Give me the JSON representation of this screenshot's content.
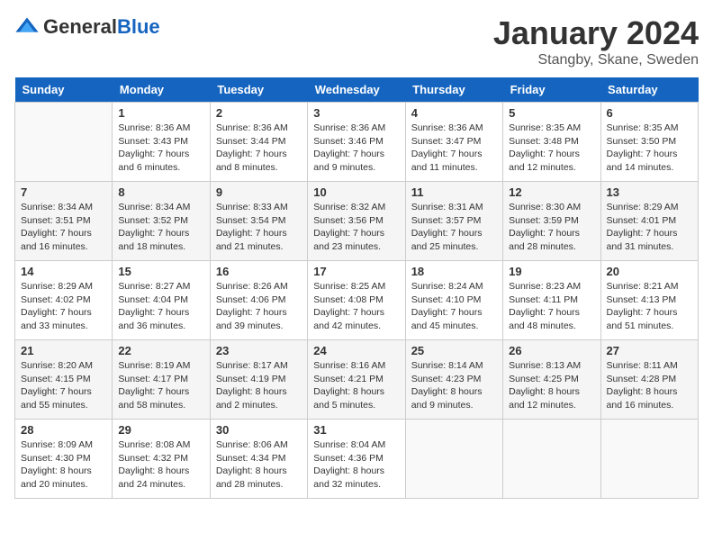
{
  "header": {
    "logo": {
      "general": "General",
      "blue": "Blue"
    },
    "title": "January 2024",
    "location": "Stangby, Skane, Sweden"
  },
  "weekdays": [
    "Sunday",
    "Monday",
    "Tuesday",
    "Wednesday",
    "Thursday",
    "Friday",
    "Saturday"
  ],
  "weeks": [
    [
      {
        "day": "",
        "info": ""
      },
      {
        "day": "1",
        "info": "Sunrise: 8:36 AM\nSunset: 3:43 PM\nDaylight: 7 hours\nand 6 minutes."
      },
      {
        "day": "2",
        "info": "Sunrise: 8:36 AM\nSunset: 3:44 PM\nDaylight: 7 hours\nand 8 minutes."
      },
      {
        "day": "3",
        "info": "Sunrise: 8:36 AM\nSunset: 3:46 PM\nDaylight: 7 hours\nand 9 minutes."
      },
      {
        "day": "4",
        "info": "Sunrise: 8:36 AM\nSunset: 3:47 PM\nDaylight: 7 hours\nand 11 minutes."
      },
      {
        "day": "5",
        "info": "Sunrise: 8:35 AM\nSunset: 3:48 PM\nDaylight: 7 hours\nand 12 minutes."
      },
      {
        "day": "6",
        "info": "Sunrise: 8:35 AM\nSunset: 3:50 PM\nDaylight: 7 hours\nand 14 minutes."
      }
    ],
    [
      {
        "day": "7",
        "info": "Sunrise: 8:34 AM\nSunset: 3:51 PM\nDaylight: 7 hours\nand 16 minutes."
      },
      {
        "day": "8",
        "info": "Sunrise: 8:34 AM\nSunset: 3:52 PM\nDaylight: 7 hours\nand 18 minutes."
      },
      {
        "day": "9",
        "info": "Sunrise: 8:33 AM\nSunset: 3:54 PM\nDaylight: 7 hours\nand 21 minutes."
      },
      {
        "day": "10",
        "info": "Sunrise: 8:32 AM\nSunset: 3:56 PM\nDaylight: 7 hours\nand 23 minutes."
      },
      {
        "day": "11",
        "info": "Sunrise: 8:31 AM\nSunset: 3:57 PM\nDaylight: 7 hours\nand 25 minutes."
      },
      {
        "day": "12",
        "info": "Sunrise: 8:30 AM\nSunset: 3:59 PM\nDaylight: 7 hours\nand 28 minutes."
      },
      {
        "day": "13",
        "info": "Sunrise: 8:29 AM\nSunset: 4:01 PM\nDaylight: 7 hours\nand 31 minutes."
      }
    ],
    [
      {
        "day": "14",
        "info": "Sunrise: 8:29 AM\nSunset: 4:02 PM\nDaylight: 7 hours\nand 33 minutes."
      },
      {
        "day": "15",
        "info": "Sunrise: 8:27 AM\nSunset: 4:04 PM\nDaylight: 7 hours\nand 36 minutes."
      },
      {
        "day": "16",
        "info": "Sunrise: 8:26 AM\nSunset: 4:06 PM\nDaylight: 7 hours\nand 39 minutes."
      },
      {
        "day": "17",
        "info": "Sunrise: 8:25 AM\nSunset: 4:08 PM\nDaylight: 7 hours\nand 42 minutes."
      },
      {
        "day": "18",
        "info": "Sunrise: 8:24 AM\nSunset: 4:10 PM\nDaylight: 7 hours\nand 45 minutes."
      },
      {
        "day": "19",
        "info": "Sunrise: 8:23 AM\nSunset: 4:11 PM\nDaylight: 7 hours\nand 48 minutes."
      },
      {
        "day": "20",
        "info": "Sunrise: 8:21 AM\nSunset: 4:13 PM\nDaylight: 7 hours\nand 51 minutes."
      }
    ],
    [
      {
        "day": "21",
        "info": "Sunrise: 8:20 AM\nSunset: 4:15 PM\nDaylight: 7 hours\nand 55 minutes."
      },
      {
        "day": "22",
        "info": "Sunrise: 8:19 AM\nSunset: 4:17 PM\nDaylight: 7 hours\nand 58 minutes."
      },
      {
        "day": "23",
        "info": "Sunrise: 8:17 AM\nSunset: 4:19 PM\nDaylight: 8 hours\nand 2 minutes."
      },
      {
        "day": "24",
        "info": "Sunrise: 8:16 AM\nSunset: 4:21 PM\nDaylight: 8 hours\nand 5 minutes."
      },
      {
        "day": "25",
        "info": "Sunrise: 8:14 AM\nSunset: 4:23 PM\nDaylight: 8 hours\nand 9 minutes."
      },
      {
        "day": "26",
        "info": "Sunrise: 8:13 AM\nSunset: 4:25 PM\nDaylight: 8 hours\nand 12 minutes."
      },
      {
        "day": "27",
        "info": "Sunrise: 8:11 AM\nSunset: 4:28 PM\nDaylight: 8 hours\nand 16 minutes."
      }
    ],
    [
      {
        "day": "28",
        "info": "Sunrise: 8:09 AM\nSunset: 4:30 PM\nDaylight: 8 hours\nand 20 minutes."
      },
      {
        "day": "29",
        "info": "Sunrise: 8:08 AM\nSunset: 4:32 PM\nDaylight: 8 hours\nand 24 minutes."
      },
      {
        "day": "30",
        "info": "Sunrise: 8:06 AM\nSunset: 4:34 PM\nDaylight: 8 hours\nand 28 minutes."
      },
      {
        "day": "31",
        "info": "Sunrise: 8:04 AM\nSunset: 4:36 PM\nDaylight: 8 hours\nand 32 minutes."
      },
      {
        "day": "",
        "info": ""
      },
      {
        "day": "",
        "info": ""
      },
      {
        "day": "",
        "info": ""
      }
    ]
  ]
}
